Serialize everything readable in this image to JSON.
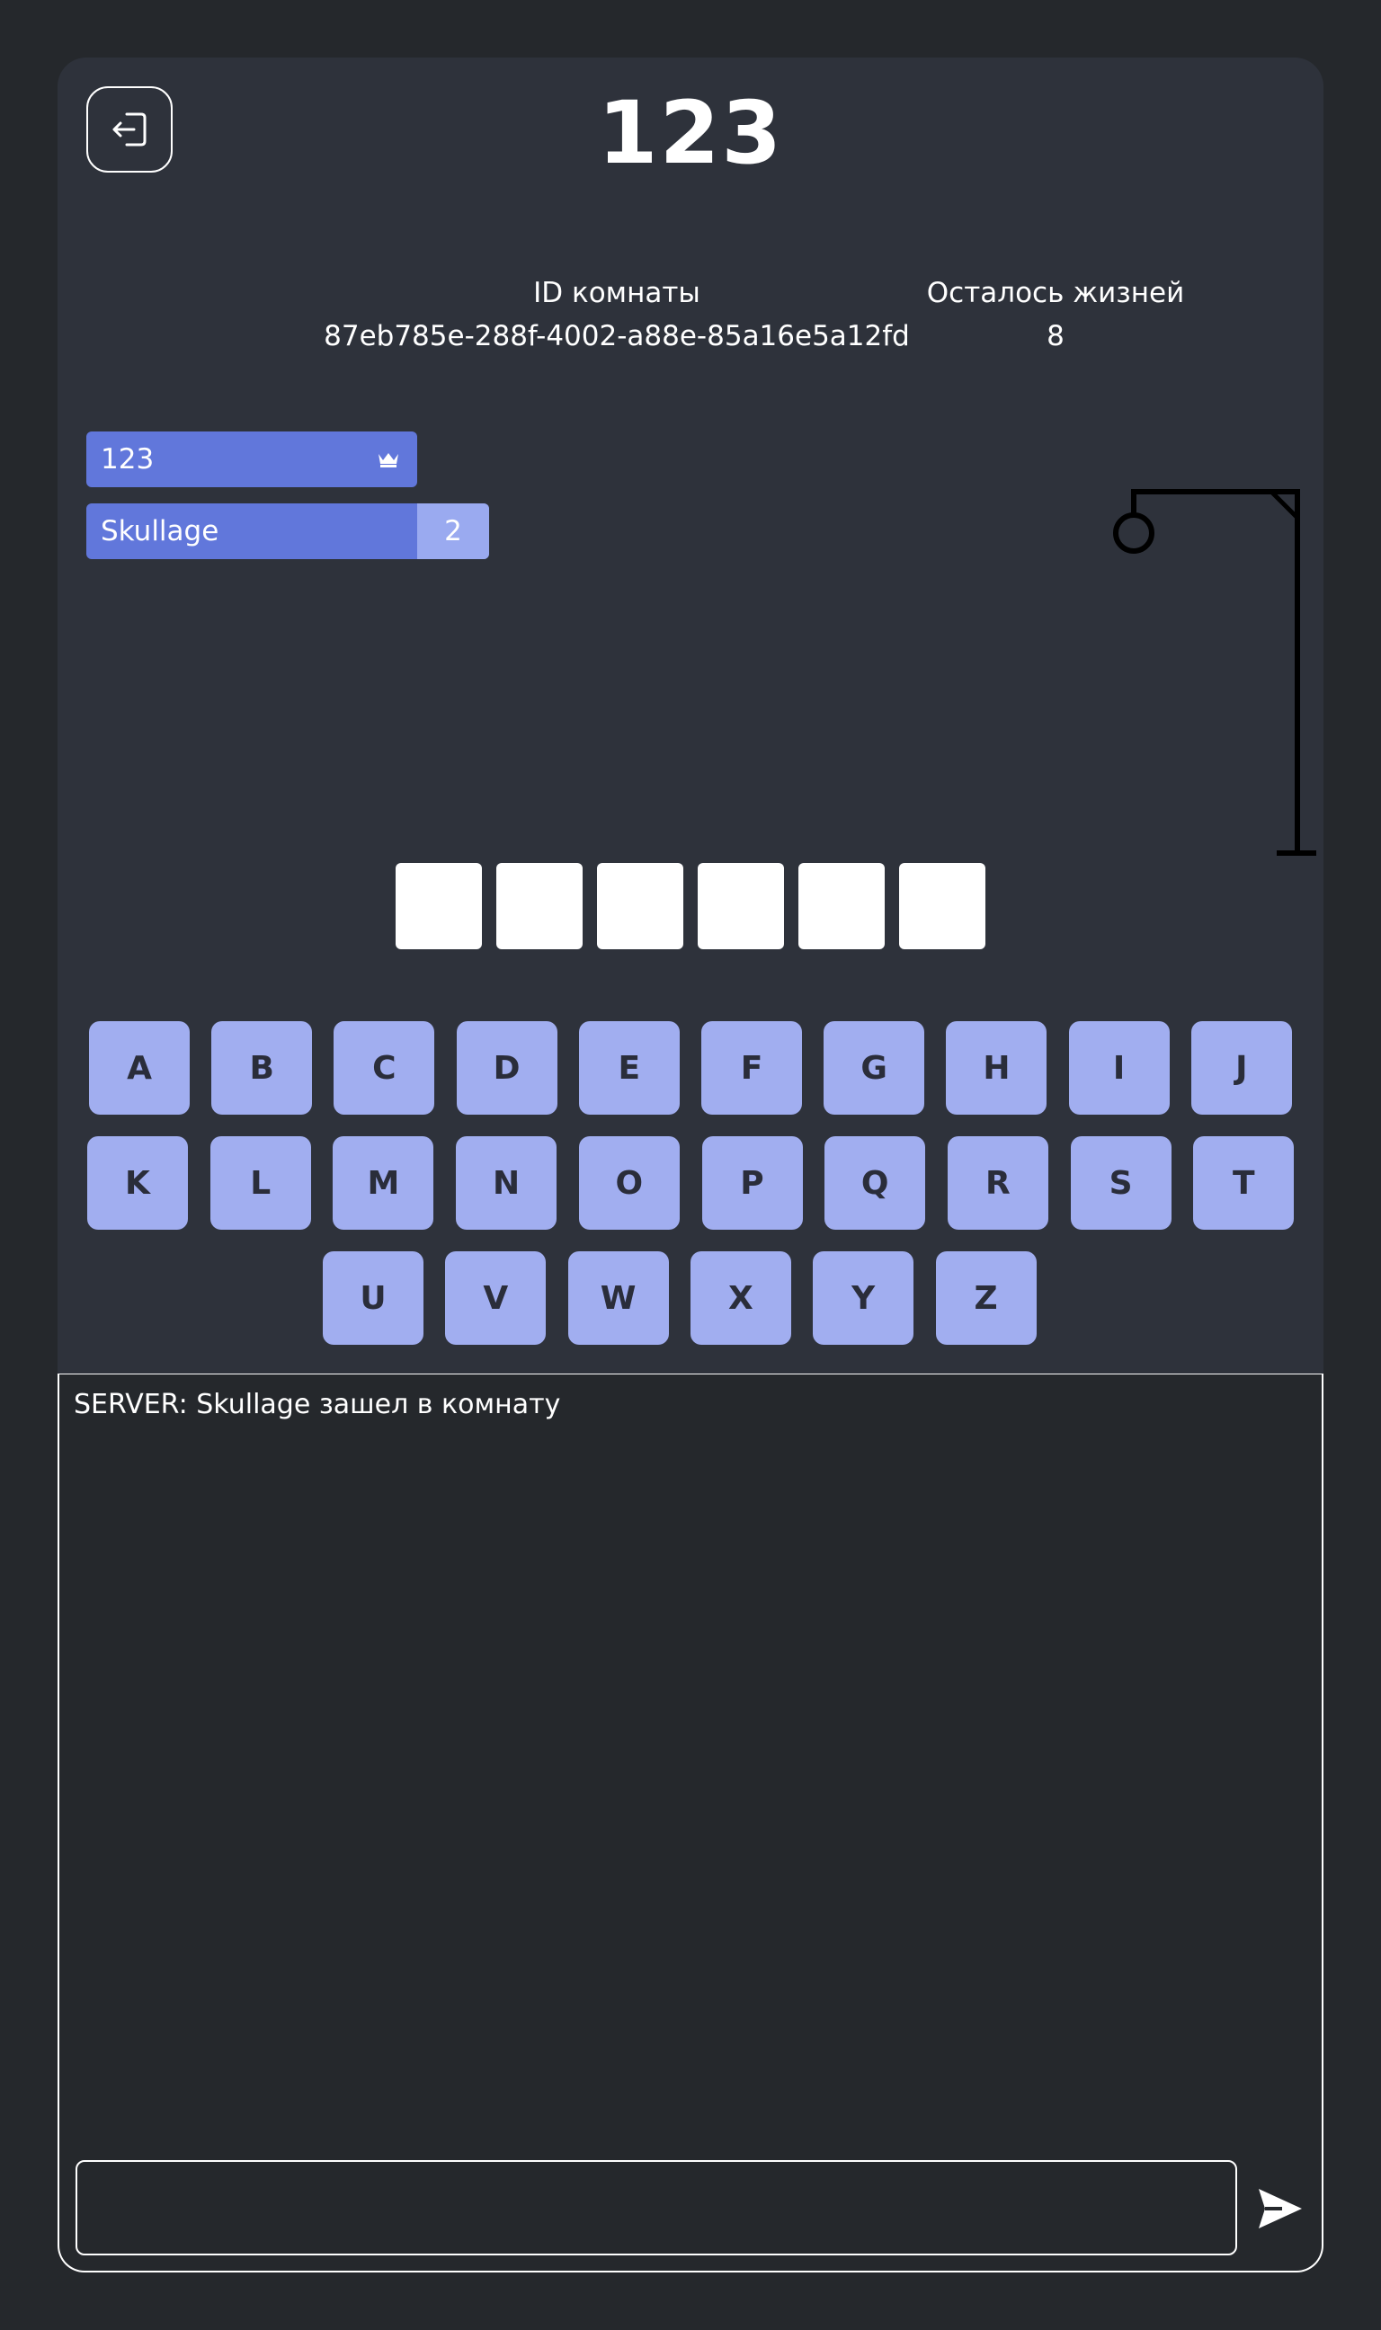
{
  "room": {
    "title": "123",
    "id_label": "ID комнаты",
    "id_value": "87eb785e-288f-4002-a88e-85a16e5a12fd",
    "lives_label": "Осталось жизней",
    "lives_value": "8"
  },
  "players": [
    {
      "name": "123",
      "host": true,
      "icon": "crown-icon"
    },
    {
      "name": "Skullage",
      "score": "2"
    }
  ],
  "word": {
    "length": 6
  },
  "keyboard": {
    "rows": [
      [
        "A",
        "B",
        "C",
        "D",
        "E",
        "F",
        "G",
        "H",
        "I",
        "J"
      ],
      [
        "K",
        "L",
        "M",
        "N",
        "O",
        "P",
        "Q",
        "R",
        "S",
        "T"
      ],
      [
        "U",
        "V",
        "W",
        "X",
        "Y",
        "Z"
      ]
    ]
  },
  "chat": {
    "messages": [
      "SERVER: Skullage зашел в комнату"
    ],
    "input_value": "",
    "send_icon": "send-icon"
  },
  "colors": {
    "background": "#25282c",
    "card": "#2e323b",
    "player_bar": "#6177db",
    "score_badge": "#9aaaf0",
    "key": "#a1aef0"
  }
}
